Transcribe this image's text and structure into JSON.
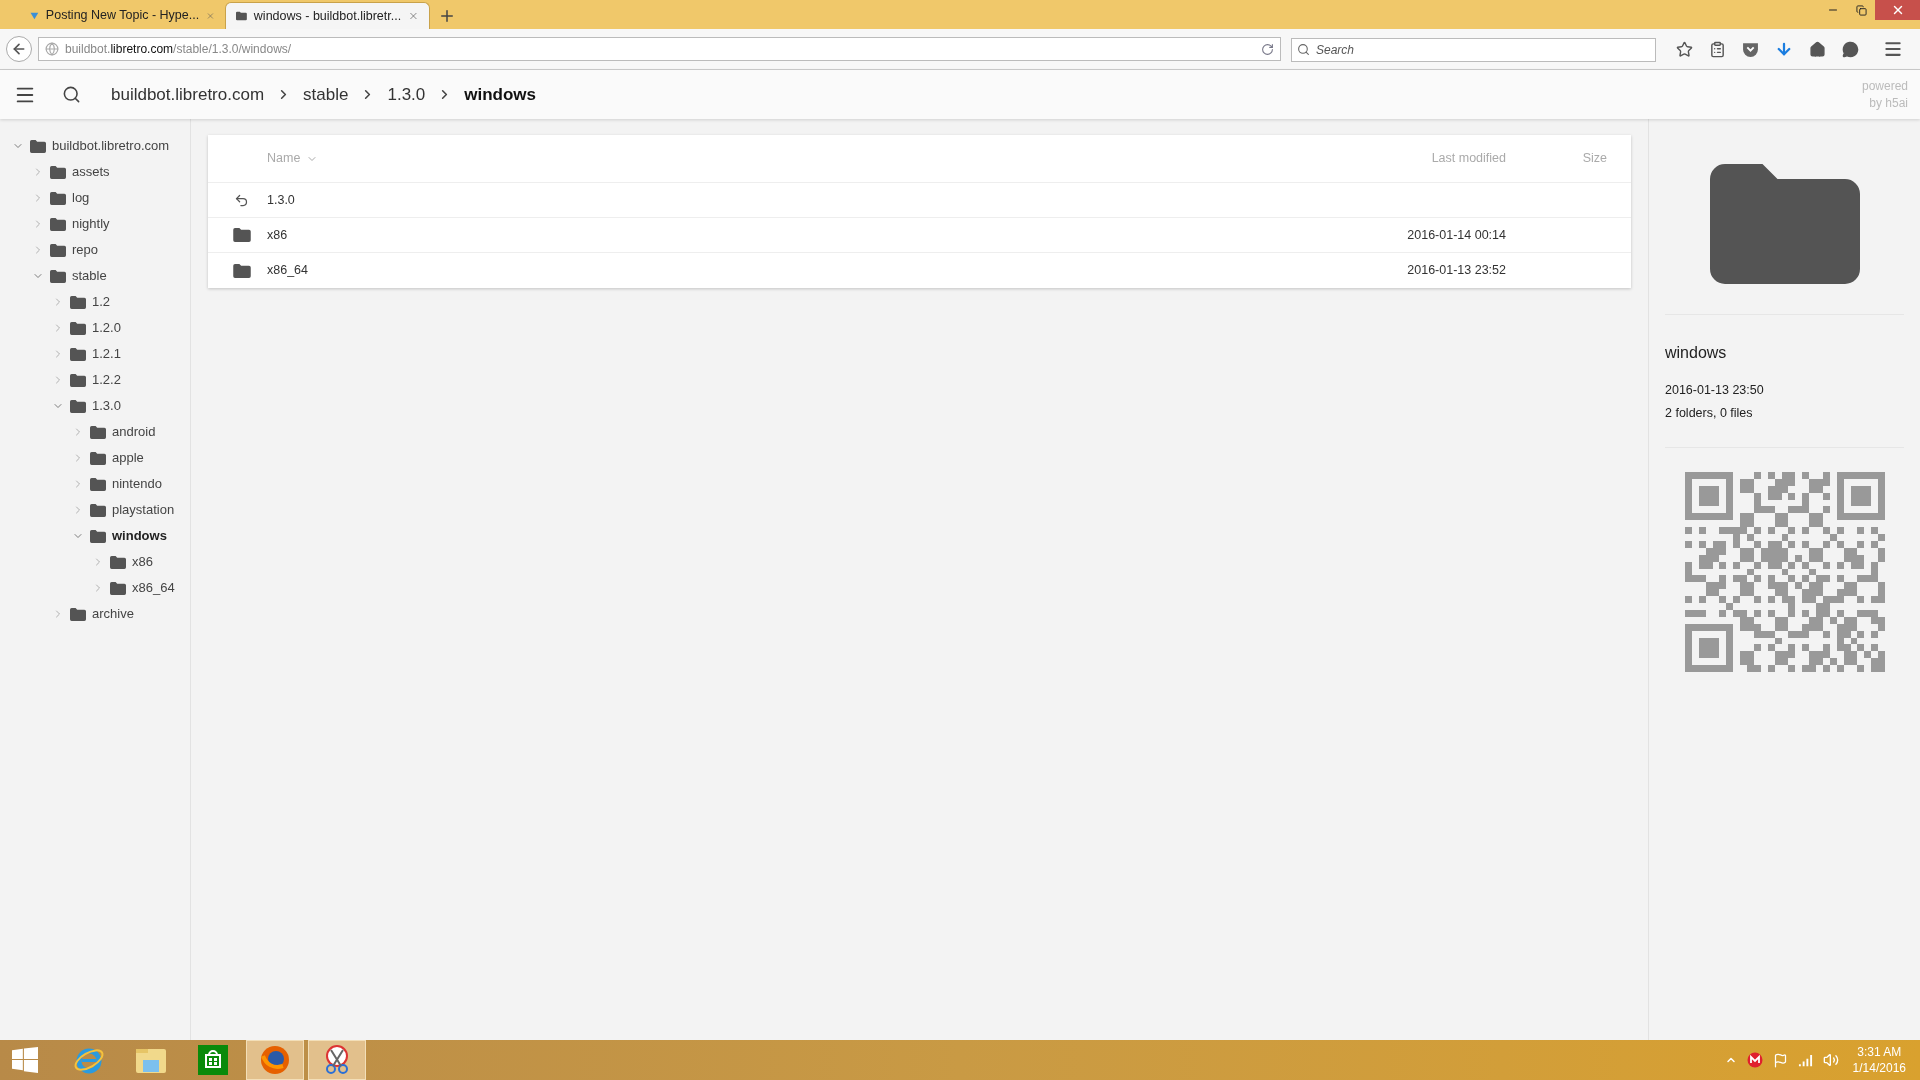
{
  "browser": {
    "tabs": [
      {
        "title": "Posting New Topic - Hype...",
        "kind": "forum",
        "selected": false
      },
      {
        "title": "windows - buildbot.libretr...",
        "kind": "folder",
        "selected": true
      }
    ],
    "address": {
      "subdomain": "buildbot.",
      "domain": "libretro.com",
      "path": "/stable/1.3.0/windows/"
    },
    "search": {
      "placeholder": "Search"
    }
  },
  "header": {
    "breadcrumbs": [
      {
        "label": "buildbot.libretro.com",
        "current": false
      },
      {
        "label": "stable",
        "current": false
      },
      {
        "label": "1.3.0",
        "current": false
      },
      {
        "label": "windows",
        "current": true
      }
    ],
    "powered_by": "powered by h5ai"
  },
  "tree": {
    "label": "buildbot.libretro.com",
    "expanded": true,
    "selected": false,
    "children": [
      {
        "label": "assets",
        "expanded": false,
        "selected": false
      },
      {
        "label": "log",
        "expanded": false,
        "selected": false
      },
      {
        "label": "nightly",
        "expanded": false,
        "selected": false
      },
      {
        "label": "repo",
        "expanded": false,
        "selected": false
      },
      {
        "label": "stable",
        "expanded": true,
        "selected": false,
        "children": [
          {
            "label": "1.2",
            "expanded": false,
            "selected": false
          },
          {
            "label": "1.2.0",
            "expanded": false,
            "selected": false
          },
          {
            "label": "1.2.1",
            "expanded": false,
            "selected": false
          },
          {
            "label": "1.2.2",
            "expanded": false,
            "selected": false
          },
          {
            "label": "1.3.0",
            "expanded": true,
            "selected": false,
            "children": [
              {
                "label": "android",
                "expanded": false,
                "selected": false
              },
              {
                "label": "apple",
                "expanded": false,
                "selected": false
              },
              {
                "label": "nintendo",
                "expanded": false,
                "selected": false
              },
              {
                "label": "playstation",
                "expanded": false,
                "selected": false
              },
              {
                "label": "windows",
                "expanded": true,
                "selected": true,
                "children": [
                  {
                    "label": "x86",
                    "expanded": false,
                    "selected": false
                  },
                  {
                    "label": "x86_64",
                    "expanded": false,
                    "selected": false
                  }
                ]
              }
            ]
          },
          {
            "label": "archive",
            "expanded": false,
            "selected": false
          }
        ]
      }
    ]
  },
  "table": {
    "columns": [
      {
        "label": "Name",
        "sorted": true
      },
      {
        "label": "Last modified",
        "sorted": false
      },
      {
        "label": "Size",
        "sorted": false
      }
    ],
    "rows": [
      {
        "kind": "parent",
        "name": "1.3.0"
      },
      {
        "kind": "folder",
        "name": "x86",
        "modified": "2016-01-14 00:14"
      },
      {
        "kind": "folder",
        "name": "x86_64",
        "modified": "2016-01-13 23:52"
      }
    ]
  },
  "info": {
    "name": "windows",
    "modified": "2016-01-13 23:50",
    "summary": "2 folders, 0 files"
  },
  "taskbar": {
    "apps": [
      {
        "kind": "ie",
        "active": false
      },
      {
        "kind": "explorer",
        "active": false
      },
      {
        "kind": "store",
        "active": false
      },
      {
        "kind": "firefox",
        "active": true
      },
      {
        "kind": "snipping",
        "active": true
      }
    ],
    "clock": {
      "time": "3:31 AM",
      "date": "1/14/2016"
    }
  }
}
